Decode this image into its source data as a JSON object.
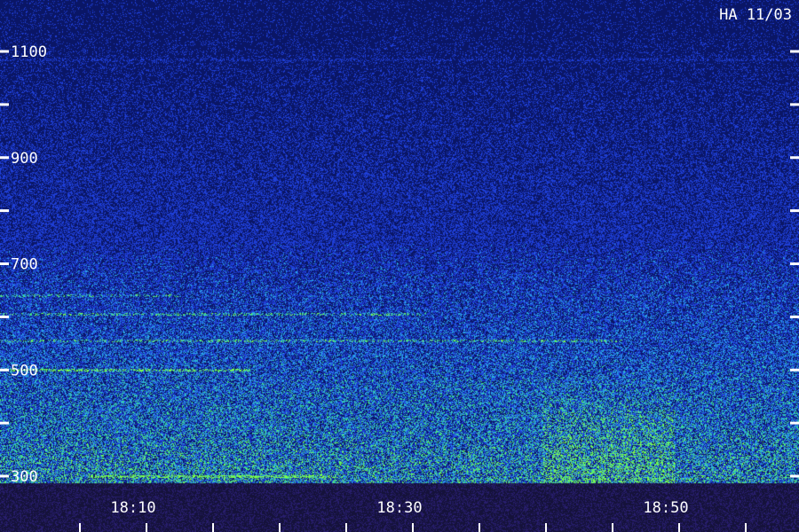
{
  "chart_data": {
    "type": "heatmap",
    "title": "",
    "station_label": "HA 11/03",
    "xlabel": "",
    "ylabel": "",
    "x_ticks": [
      {
        "value": "18:10",
        "minute": 10
      },
      {
        "value": "18:30",
        "minute": 30
      },
      {
        "value": "18:50",
        "minute": 50
      }
    ],
    "x_range_minutes": [
      8.5,
      58.5
    ],
    "y_ticks": [
      300,
      500,
      700,
      900,
      1100
    ],
    "y_minor_ticks": [
      400,
      600,
      800,
      1000,
      1200
    ],
    "y_range": [
      280,
      1200
    ],
    "colors": {
      "background": "#0a1666",
      "low": "#1f3fd8",
      "mid": "#2aa6e6",
      "high": "#3fe08a",
      "peak": "#7cff4a",
      "floor": "#15123a",
      "text": "#ffffff"
    }
  }
}
